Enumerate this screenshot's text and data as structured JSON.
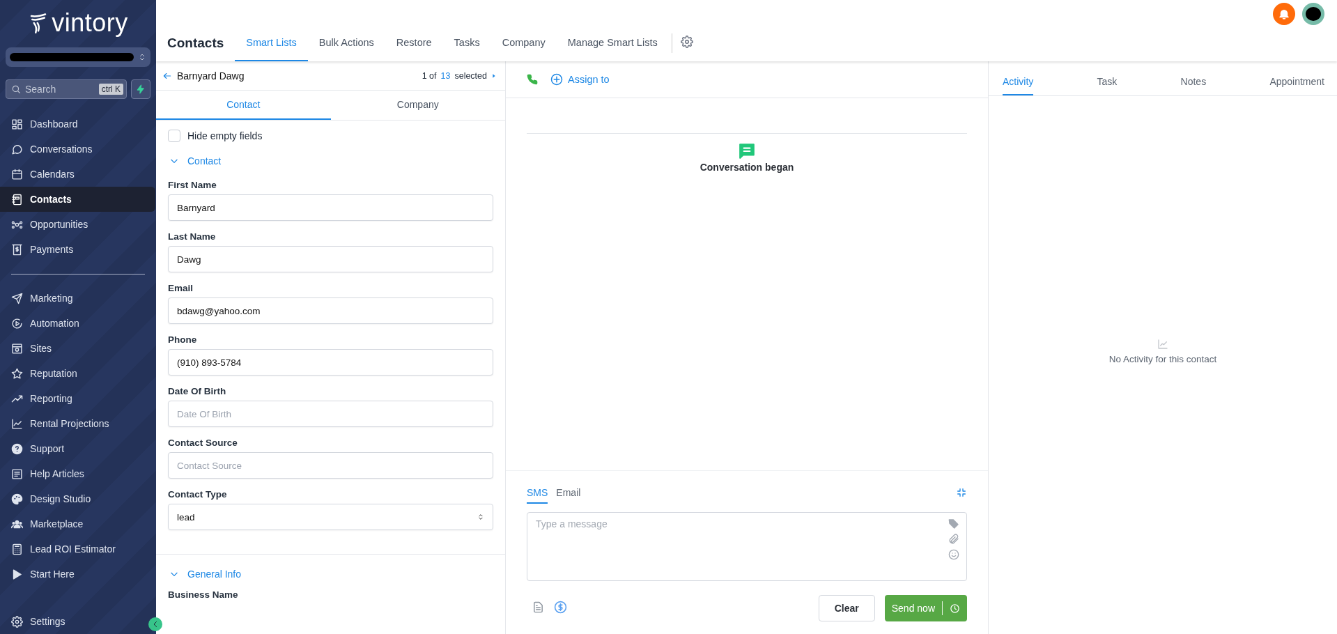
{
  "sidebar": {
    "logo": "vintory",
    "search": {
      "placeholder": "Search",
      "shortcut": "ctrl K"
    },
    "nav_groups": [
      [
        {
          "label": "Dashboard",
          "selected": false
        },
        {
          "label": "Conversations",
          "selected": false
        },
        {
          "label": "Calendars",
          "selected": false
        },
        {
          "label": "Contacts",
          "selected": true
        },
        {
          "label": "Opportunities",
          "selected": false
        },
        {
          "label": "Payments",
          "selected": false
        }
      ],
      [
        {
          "label": "Marketing",
          "selected": false
        },
        {
          "label": "Automation",
          "selected": false
        },
        {
          "label": "Sites",
          "selected": false
        },
        {
          "label": "Reputation",
          "selected": false
        },
        {
          "label": "Reporting",
          "selected": false
        },
        {
          "label": "Rental Projections",
          "selected": false
        },
        {
          "label": "Support",
          "selected": false
        },
        {
          "label": "Help Articles",
          "selected": false
        },
        {
          "label": "Design Studio",
          "selected": false
        },
        {
          "label": "Marketplace",
          "selected": false
        },
        {
          "label": "Lead ROI Estimator",
          "selected": false
        },
        {
          "label": "Start Here",
          "selected": false
        }
      ]
    ],
    "settings": "Settings"
  },
  "header": {
    "title": "Contacts",
    "tabs": [
      {
        "label": "Smart Lists",
        "selected": true
      },
      {
        "label": "Bulk Actions",
        "selected": false
      },
      {
        "label": "Restore",
        "selected": false
      },
      {
        "label": "Tasks",
        "selected": false
      },
      {
        "label": "Company",
        "selected": false
      },
      {
        "label": "Manage Smart Lists",
        "selected": false
      }
    ]
  },
  "contact_panel": {
    "name": "Barnyard Dawg",
    "pager": {
      "position": "1 of",
      "total": "13",
      "suffix": "selected"
    },
    "tabs": [
      {
        "label": "Contact",
        "selected": true
      },
      {
        "label": "Company",
        "selected": false
      }
    ],
    "hide_empty": {
      "label": "Hide empty fields",
      "checked": false
    },
    "section": {
      "title": "Contact",
      "expanded": true
    },
    "fields": [
      {
        "kind": "text",
        "label": "First Name",
        "value": "Barnyard"
      },
      {
        "kind": "text",
        "label": "Last Name",
        "value": "Dawg"
      },
      {
        "kind": "text",
        "label": "Email",
        "value": "bdawg@yahoo.com"
      },
      {
        "kind": "text",
        "label": "Phone",
        "value": "(910) 893-5784"
      },
      {
        "kind": "text",
        "label": "Date Of Birth",
        "placeholder": "Date Of Birth"
      },
      {
        "kind": "text",
        "label": "Contact Source",
        "placeholder": "Contact Source"
      },
      {
        "kind": "select",
        "label": "Contact Type",
        "value": "lead"
      }
    ],
    "next_section": {
      "title": "General Info",
      "expanded": true
    },
    "next_field_label": "Business Name"
  },
  "conversation": {
    "assign": "Assign to",
    "event": "Conversation began",
    "composer": {
      "tabs": [
        {
          "label": "SMS",
          "selected": true
        },
        {
          "label": "Email",
          "selected": false
        }
      ],
      "placeholder": "Type a message",
      "clear": "Clear",
      "send": "Send now"
    }
  },
  "activity": {
    "tabs": [
      {
        "label": "Activity",
        "selected": true
      },
      {
        "label": "Task",
        "selected": false
      },
      {
        "label": "Notes",
        "selected": false
      },
      {
        "label": "Appointment",
        "selected": false
      }
    ],
    "empty": "No Activity for this contact"
  }
}
